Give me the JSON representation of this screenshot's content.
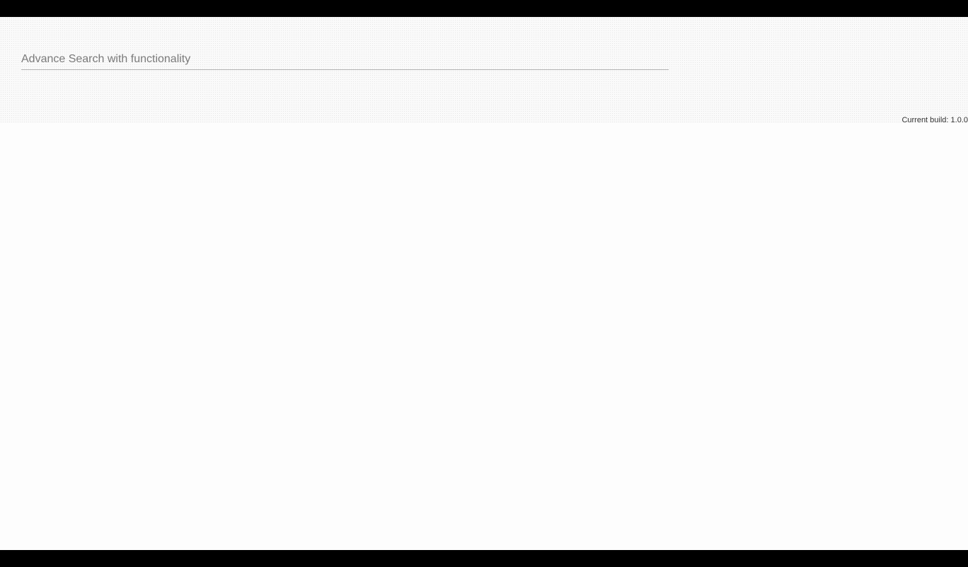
{
  "search": {
    "placeholder": "Advance Search with functionality",
    "value": ""
  },
  "footer": {
    "build_label": "Current build: 1.0.0"
  },
  "colors": {
    "letterbox": "#000000",
    "page_background": "#fdfdfd",
    "header_background": "#fafafa",
    "search_underline": "#b5b5b5"
  }
}
